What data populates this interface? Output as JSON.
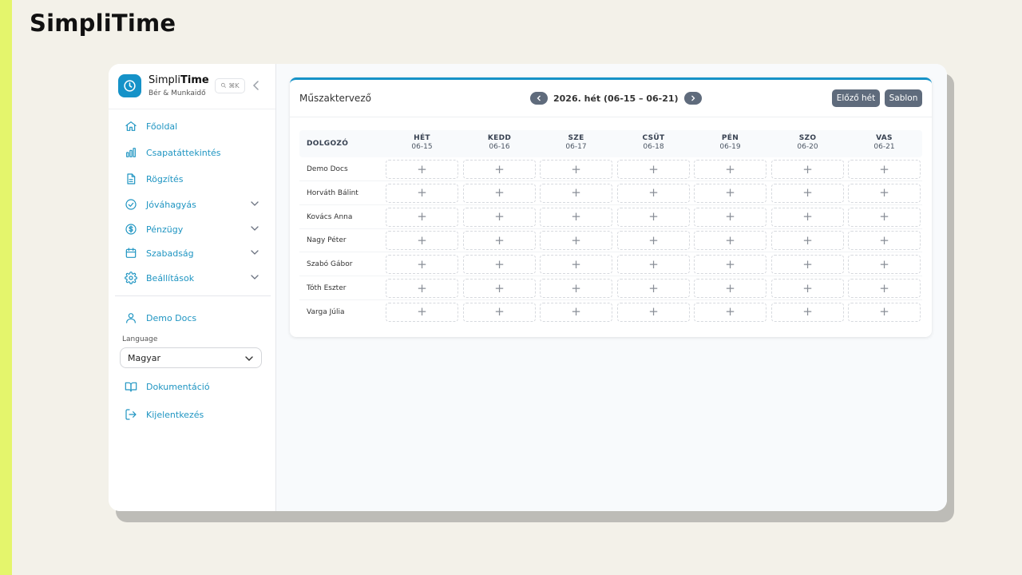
{
  "page": {
    "title": "SimpliTime"
  },
  "brand": {
    "name_part1": "Simpli",
    "name_part2": "Time",
    "subtitle": "Bér & Munkaidő",
    "search_shortcut": "⌘K"
  },
  "sidebar": {
    "items": [
      {
        "label": "Főoldal",
        "icon": "home-icon",
        "expandable": false
      },
      {
        "label": "Csapatáttekintés",
        "icon": "bar-chart-icon",
        "expandable": false
      },
      {
        "label": "Rögzítés",
        "icon": "document-icon",
        "expandable": false
      },
      {
        "label": "Jóváhagyás",
        "icon": "check-circle-icon",
        "expandable": true
      },
      {
        "label": "Pénzügy",
        "icon": "dollar-icon",
        "expandable": true
      },
      {
        "label": "Szabadság",
        "icon": "calendar-icon",
        "expandable": true
      },
      {
        "label": "Beállítások",
        "icon": "gear-icon",
        "expandable": true
      }
    ],
    "user": {
      "name": "Demo Docs",
      "icon": "user-icon"
    },
    "language": {
      "label": "Language",
      "value": "Magyar"
    },
    "docs_label": "Dokumentáció",
    "logout_label": "Kijelentkezés"
  },
  "planner": {
    "title": "Műszaktervező",
    "week_label": "2026. hét (06-15 – 06-21)",
    "prev_week_button": "Előző hét",
    "template_button": "Sablon",
    "employee_column": "DOLGOZÓ",
    "days": [
      {
        "name": "HÉT",
        "date": "06-15"
      },
      {
        "name": "KEDD",
        "date": "06-16"
      },
      {
        "name": "SZE",
        "date": "06-17"
      },
      {
        "name": "CSÜT",
        "date": "06-18"
      },
      {
        "name": "PÉN",
        "date": "06-19"
      },
      {
        "name": "SZO",
        "date": "06-20"
      },
      {
        "name": "VAS",
        "date": "06-21"
      }
    ],
    "employees": [
      "Demo Docs",
      "Horváth Bálint",
      "Kovács Anna",
      "Nagy Péter",
      "Szabó Gábor",
      "Tóth Eszter",
      "Varga Júlia"
    ],
    "add_cell_symbol": "+"
  },
  "colors": {
    "accent": "#1592c8",
    "link": "#1f95c2",
    "button": "#5f6b7c",
    "stripe": "#e4f56c"
  }
}
